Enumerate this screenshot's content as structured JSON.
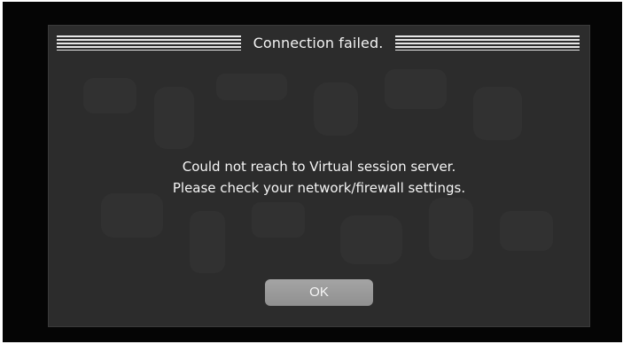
{
  "dialog": {
    "title": "Connection failed.",
    "message_line1": "Could not reach to Virtual session server.",
    "message_line2": "Please check your network/firewall settings.",
    "ok_label": "OK"
  },
  "colors": {
    "screen_background": "#050505",
    "dialog_background": "#2c2c2c",
    "title_stripes": "#e6e6e6",
    "text": "#f5f5f5",
    "button": "#9a9a9a"
  }
}
